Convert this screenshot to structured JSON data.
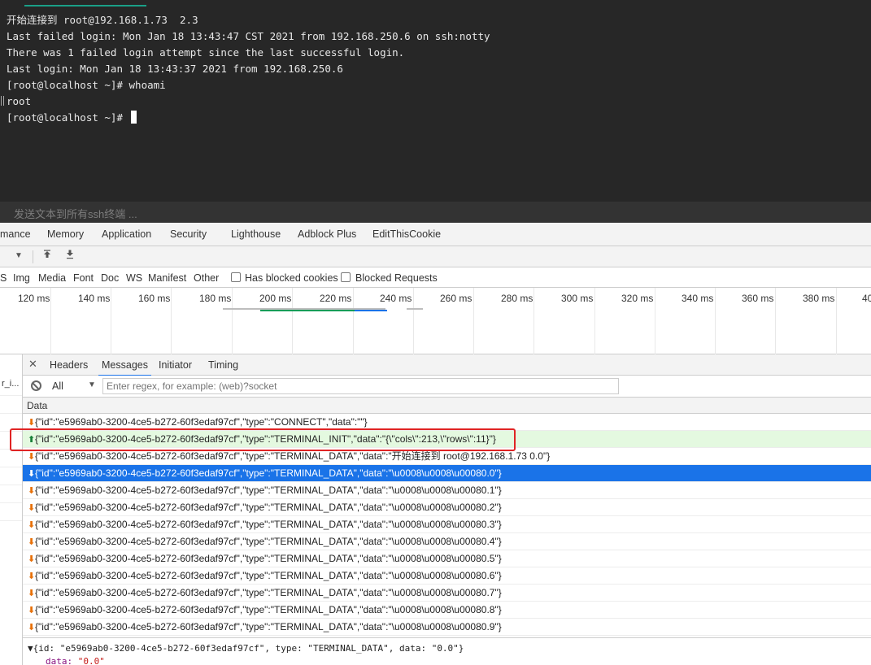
{
  "terminal": {
    "lines": [
      "开始连接到 root@192.168.1.73  2.3",
      "Last failed login: Mon Jan 18 13:43:47 CST 2021 from 192.168.250.6 on ssh:notty",
      "There was 1 failed login attempt since the last successful login.",
      "Last login: Mon Jan 18 13:43:37 2021 from 192.168.250.6",
      "[root@localhost ~]# whoami",
      "root",
      "[root@localhost ~]# "
    ],
    "input_placeholder": "发送文本到所有ssh终端 ..."
  },
  "devtools_tabs": [
    "mance",
    "Memory",
    "Application",
    "Security",
    "Lighthouse",
    "Adblock Plus",
    "EditThisCookie"
  ],
  "type_filters": [
    "S",
    "Img",
    "Media",
    "Font",
    "Doc",
    "WS",
    "Manifest",
    "Other"
  ],
  "checkboxes": {
    "blocked_cookies": "Has blocked cookies",
    "blocked_requests": "Blocked Requests"
  },
  "timeline": {
    "ticks": [
      "120 ms",
      "140 ms",
      "160 ms",
      "180 ms",
      "200 ms",
      "220 ms",
      "240 ms",
      "260 ms",
      "280 ms",
      "300 ms",
      "320 ms",
      "340 ms",
      "360 ms",
      "380 ms",
      "40"
    ]
  },
  "request_column": {
    "partial_label": "r_i..."
  },
  "detail_tabs": {
    "headers": "Headers",
    "messages": "Messages",
    "initiator": "Initiator",
    "timing": "Timing"
  },
  "message_filter": {
    "select_value": "All",
    "regex_placeholder": "Enter regex, for example: (web)?socket"
  },
  "column_header": "Data",
  "messages": [
    {
      "dir": "recv",
      "text": "{\"id\":\"e5969ab0-3200-4ce5-b272-60f3edaf97cf\",\"type\":\"CONNECT\",\"data\":\"\"}"
    },
    {
      "dir": "sent",
      "text": "{\"id\":\"e5969ab0-3200-4ce5-b272-60f3edaf97cf\",\"type\":\"TERMINAL_INIT\",\"data\":\"{\\\"cols\\\":213,\\\"rows\\\":11}\"}"
    },
    {
      "dir": "recv",
      "text": "{\"id\":\"e5969ab0-3200-4ce5-b272-60f3edaf97cf\",\"type\":\"TERMINAL_DATA\",\"data\":\"开始连接到 root@192.168.1.73 0.0\"}"
    },
    {
      "dir": "selected",
      "text": "{\"id\":\"e5969ab0-3200-4ce5-b272-60f3edaf97cf\",\"type\":\"TERMINAL_DATA\",\"data\":\"\\u0008\\u0008\\u00080.0\"}"
    },
    {
      "dir": "recv",
      "text": "{\"id\":\"e5969ab0-3200-4ce5-b272-60f3edaf97cf\",\"type\":\"TERMINAL_DATA\",\"data\":\"\\u0008\\u0008\\u00080.1\"}"
    },
    {
      "dir": "recv",
      "text": "{\"id\":\"e5969ab0-3200-4ce5-b272-60f3edaf97cf\",\"type\":\"TERMINAL_DATA\",\"data\":\"\\u0008\\u0008\\u00080.2\"}"
    },
    {
      "dir": "recv",
      "text": "{\"id\":\"e5969ab0-3200-4ce5-b272-60f3edaf97cf\",\"type\":\"TERMINAL_DATA\",\"data\":\"\\u0008\\u0008\\u00080.3\"}"
    },
    {
      "dir": "recv",
      "text": "{\"id\":\"e5969ab0-3200-4ce5-b272-60f3edaf97cf\",\"type\":\"TERMINAL_DATA\",\"data\":\"\\u0008\\u0008\\u00080.4\"}"
    },
    {
      "dir": "recv",
      "text": "{\"id\":\"e5969ab0-3200-4ce5-b272-60f3edaf97cf\",\"type\":\"TERMINAL_DATA\",\"data\":\"\\u0008\\u0008\\u00080.5\"}"
    },
    {
      "dir": "recv",
      "text": "{\"id\":\"e5969ab0-3200-4ce5-b272-60f3edaf97cf\",\"type\":\"TERMINAL_DATA\",\"data\":\"\\u0008\\u0008\\u00080.6\"}"
    },
    {
      "dir": "recv",
      "text": "{\"id\":\"e5969ab0-3200-4ce5-b272-60f3edaf97cf\",\"type\":\"TERMINAL_DATA\",\"data\":\"\\u0008\\u0008\\u00080.7\"}"
    },
    {
      "dir": "recv",
      "text": "{\"id\":\"e5969ab0-3200-4ce5-b272-60f3edaf97cf\",\"type\":\"TERMINAL_DATA\",\"data\":\"\\u0008\\u0008\\u00080.8\"}"
    },
    {
      "dir": "recv",
      "text": "{\"id\":\"e5969ab0-3200-4ce5-b272-60f3edaf97cf\",\"type\":\"TERMINAL_DATA\",\"data\":\"\\u0008\\u0008\\u00080.9\"}"
    }
  ],
  "arrows": {
    "up": "⬆",
    "down": "⬇"
  },
  "preview": {
    "line1": "▼{id: \"e5969ab0-3200-4ce5-b272-60f3edaf97cf\", type: \"TERMINAL_DATA\", data: \"\b\b\b0.0\"}",
    "line2_key": "data: ",
    "line2_value": "\"\b\b\b0.0\""
  },
  "colors": {
    "terminal_bg": "#272727",
    "selected_row": "#1a73e8",
    "sent_row": "#e4f9e0",
    "annotation_box": "#e02424",
    "recv_arrow": "#e8710a",
    "sent_arrow": "#188038"
  }
}
